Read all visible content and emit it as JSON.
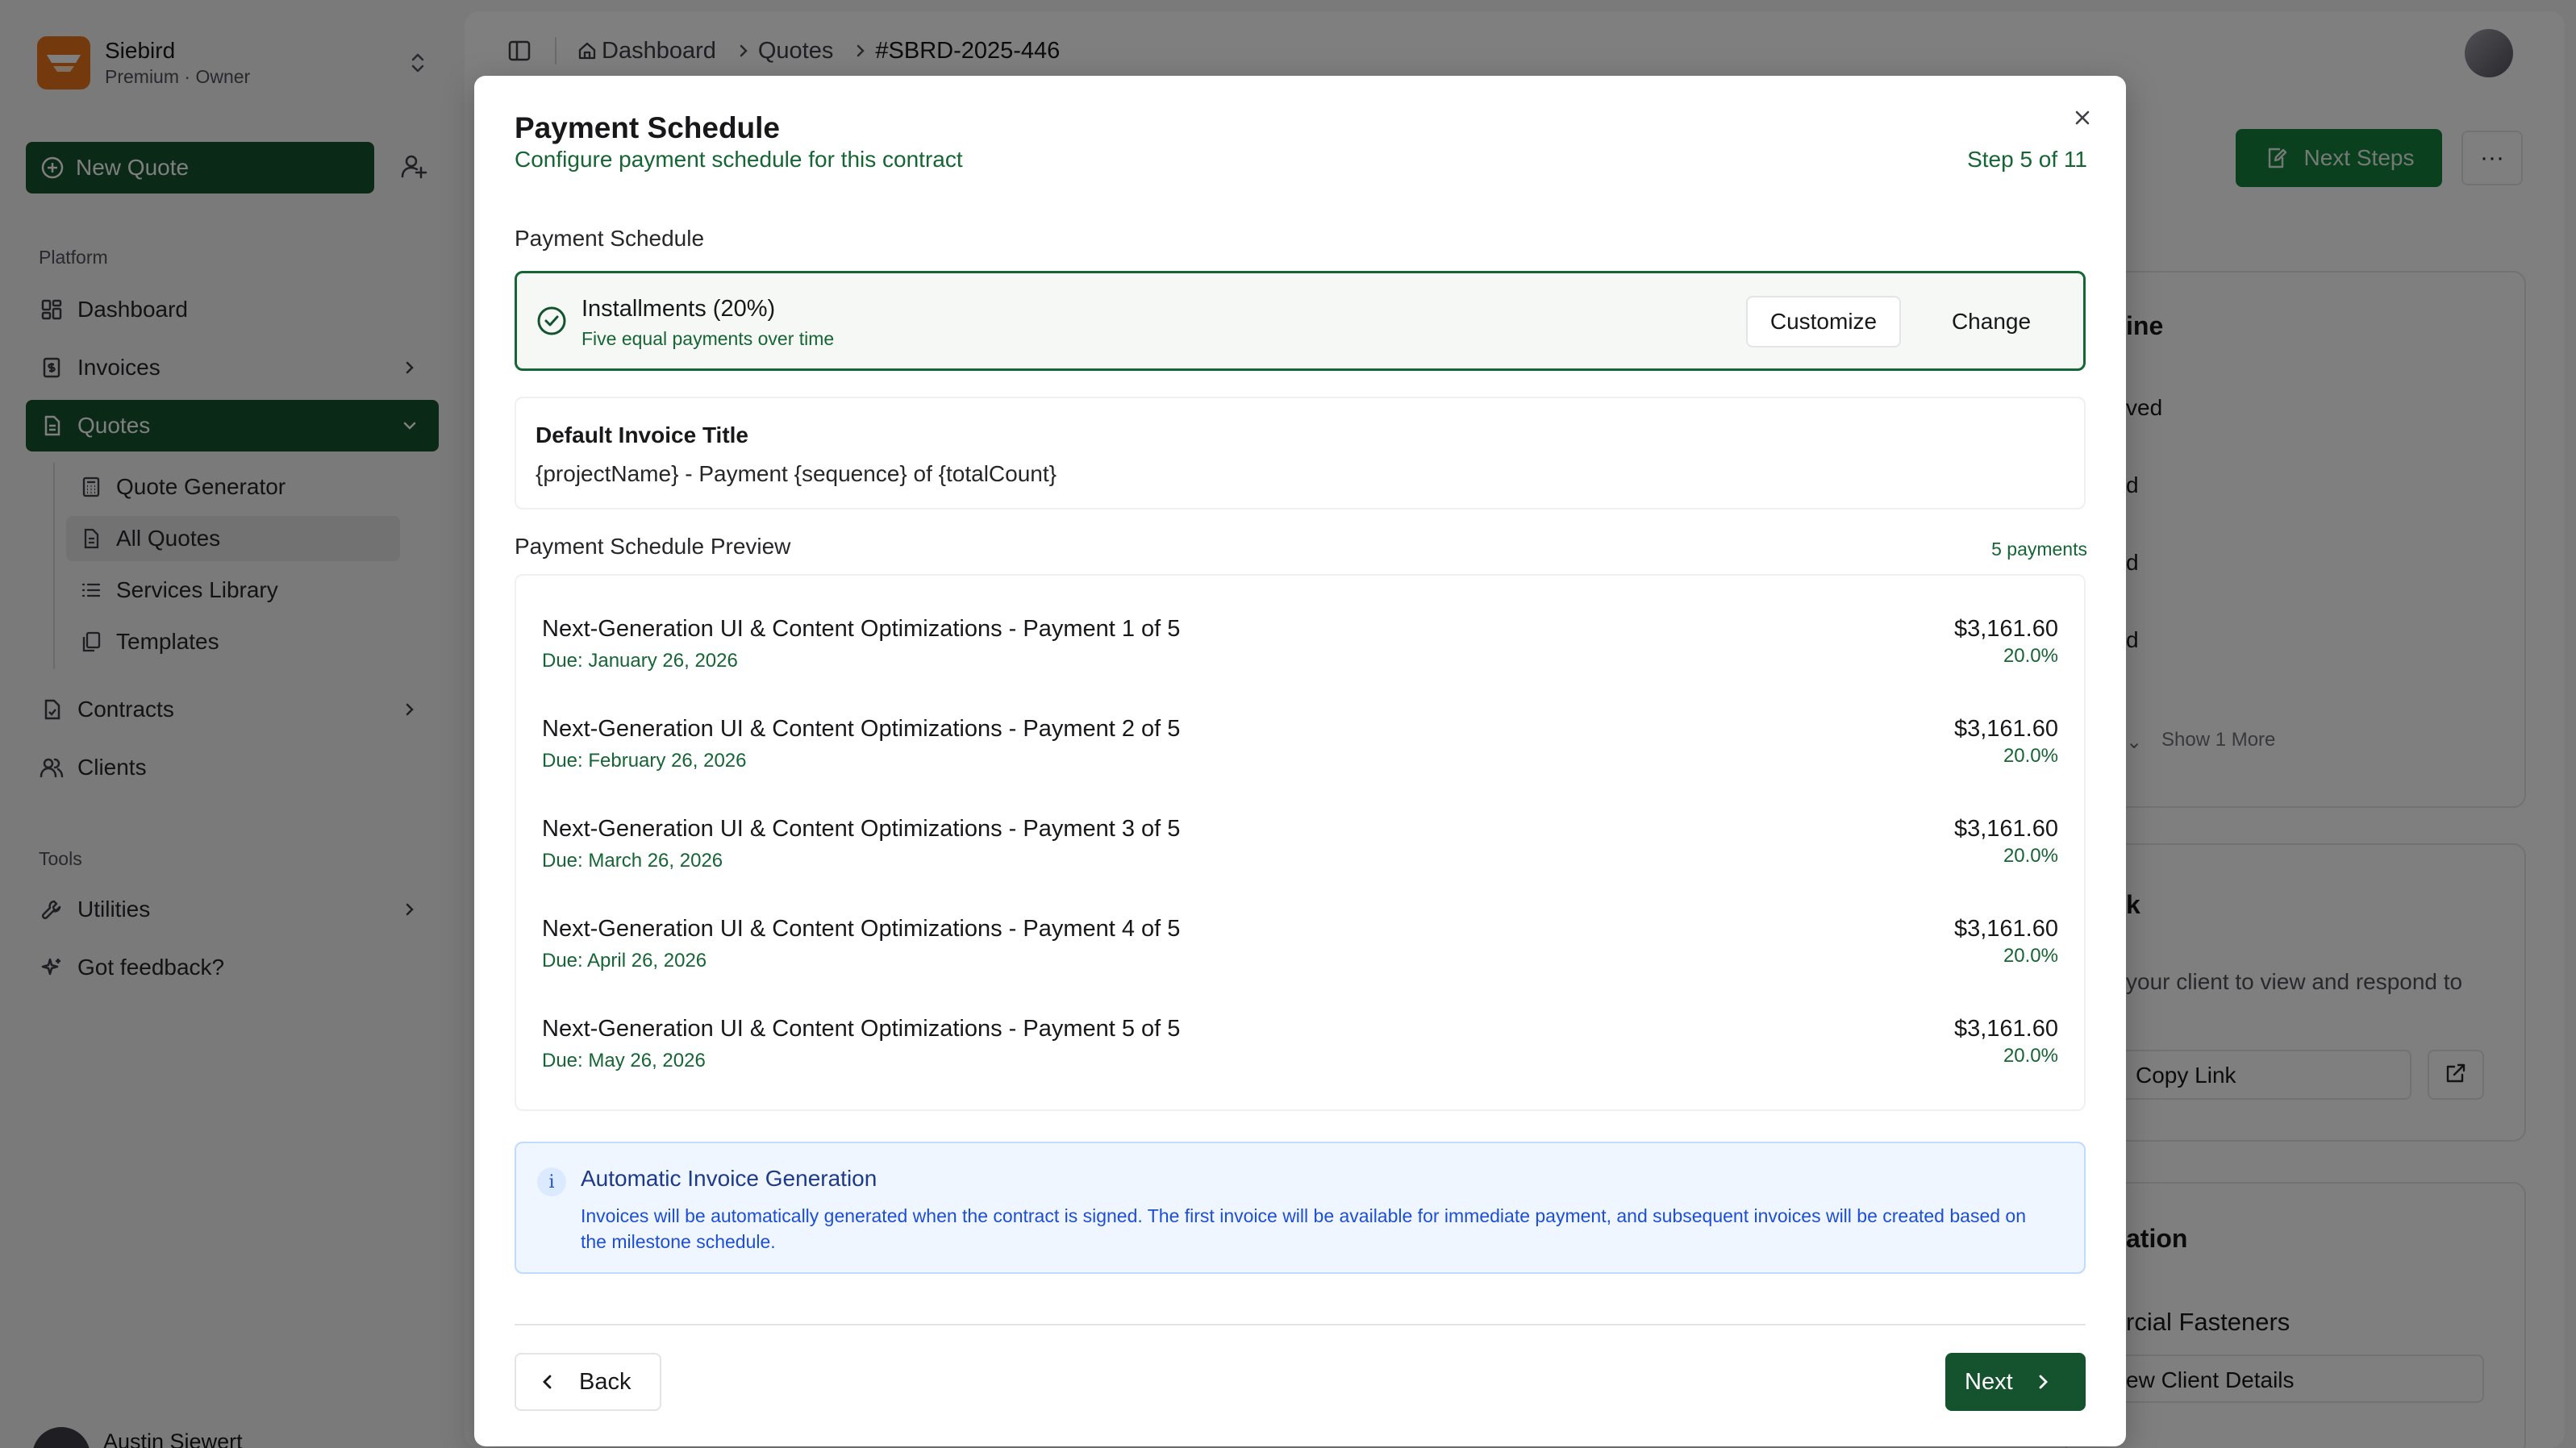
{
  "org": {
    "name": "Siebird",
    "plan": "Premium · Owner"
  },
  "sidebar": {
    "new_quote": "New Quote",
    "platform_label": "Platform",
    "tools_label": "Tools",
    "items": [
      {
        "label": "Dashboard"
      },
      {
        "label": "Invoices"
      },
      {
        "label": "Quotes"
      },
      {
        "label": "Contracts"
      },
      {
        "label": "Clients"
      },
      {
        "label": "Utilities"
      },
      {
        "label": "Got feedback?"
      }
    ],
    "quotes_sub": [
      {
        "label": "Quote Generator"
      },
      {
        "label": "All Quotes"
      },
      {
        "label": "Services Library"
      },
      {
        "label": "Templates"
      }
    ],
    "user_name": "Austin Siewert"
  },
  "breadcrumb": {
    "home": "Dashboard",
    "section": "Quotes",
    "current": "#SBRD-2025-446"
  },
  "background": {
    "next_steps": "Next Steps",
    "timeline_title": "ine",
    "timeline_items": [
      "ved",
      "d",
      "d",
      "d"
    ],
    "show_more": "Show 1 More",
    "link_title": "k",
    "link_desc": "your client to view and respond to",
    "copy_link": "Copy Link",
    "client_title": "ation",
    "client_name": "rcial Fasteners",
    "view_client": "ew Client Details"
  },
  "modal": {
    "title": "Payment Schedule",
    "subtitle": "Configure payment schedule for this contract",
    "step": "Step 5 of 11",
    "schedule_label": "Payment Schedule",
    "plan": {
      "name": "Installments (20%)",
      "description": "Five equal payments over time",
      "customize": "Customize",
      "change": "Change"
    },
    "default_title_label": "Default Invoice Title",
    "default_title_value": "{projectName} - Payment {sequence} of {totalCount}",
    "preview_label": "Payment Schedule Preview",
    "payment_count": "5 payments",
    "payments": [
      {
        "name": "Next-Generation UI & Content Optimizations - Payment 1 of 5",
        "due": "Due: January 26, 2026",
        "amount": "$3,161.60",
        "percent": "20.0%"
      },
      {
        "name": "Next-Generation UI & Content Optimizations - Payment 2 of 5",
        "due": "Due: February 26, 2026",
        "amount": "$3,161.60",
        "percent": "20.0%"
      },
      {
        "name": "Next-Generation UI & Content Optimizations - Payment 3 of 5",
        "due": "Due: March 26, 2026",
        "amount": "$3,161.60",
        "percent": "20.0%"
      },
      {
        "name": "Next-Generation UI & Content Optimizations - Payment 4 of 5",
        "due": "Due: April 26, 2026",
        "amount": "$3,161.60",
        "percent": "20.0%"
      },
      {
        "name": "Next-Generation UI & Content Optimizations - Payment 5 of 5",
        "due": "Due: May 26, 2026",
        "amount": "$3,161.60",
        "percent": "20.0%"
      }
    ],
    "info": {
      "icon": "i",
      "title": "Automatic Invoice Generation",
      "text": "Invoices will be automatically generated when the contract is signed. The first invoice will be available for immediate payment, and subsequent invoices will be created based on the milestone schedule."
    },
    "back": "Back",
    "next": "Next"
  },
  "colors": {
    "brand_green": "#14532d",
    "accent_green": "#166534",
    "info_blue": "#1d4ed8",
    "logo_orange": "#e8751a"
  }
}
